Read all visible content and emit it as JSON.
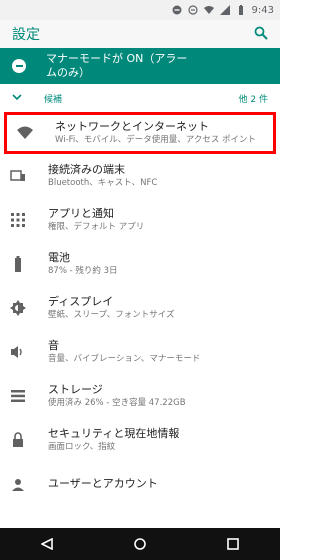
{
  "status": {
    "time": "9:43"
  },
  "appbar": {
    "title": "設定"
  },
  "banner": {
    "text": "マナーモードが ON（アラー\nムのみ）"
  },
  "suggestions": {
    "label": "候補",
    "more": "他 2 件"
  },
  "items": [
    {
      "title": "ネットワークとインターネット",
      "subtitle": "Wi-Fi、モバイル、データ使用量、アクセス ポイント"
    },
    {
      "title": "接続済みの端末",
      "subtitle": "Bluetooth、キャスト、NFC"
    },
    {
      "title": "アプリと通知",
      "subtitle": "権限、デフォルト アプリ"
    },
    {
      "title": "電池",
      "subtitle": "87% - 残り約 3日"
    },
    {
      "title": "ディスプレイ",
      "subtitle": "壁紙、スリープ、フォントサイズ"
    },
    {
      "title": "音",
      "subtitle": "音量、バイブレーション、マナーモード"
    },
    {
      "title": "ストレージ",
      "subtitle": "使用済み 26% - 空き容量 47.22GB"
    },
    {
      "title": "セキュリティと現在地情報",
      "subtitle": "画面ロック、指紋"
    },
    {
      "title": "ユーザーとアカウント",
      "subtitle": ""
    }
  ],
  "colors": {
    "accent": "#008b7a",
    "banner": "#00897b",
    "highlight": "#ff0000"
  },
  "icons": {
    "status": [
      "dnd-icon",
      "minus-icon",
      "wifi-icon",
      "signal-icon",
      "battery-icon"
    ],
    "rows": [
      "wifi-icon",
      "devices-icon",
      "apps-grid-icon",
      "battery-icon",
      "brightness-icon",
      "volume-icon",
      "storage-icon",
      "lock-icon",
      "account-icon"
    ]
  }
}
